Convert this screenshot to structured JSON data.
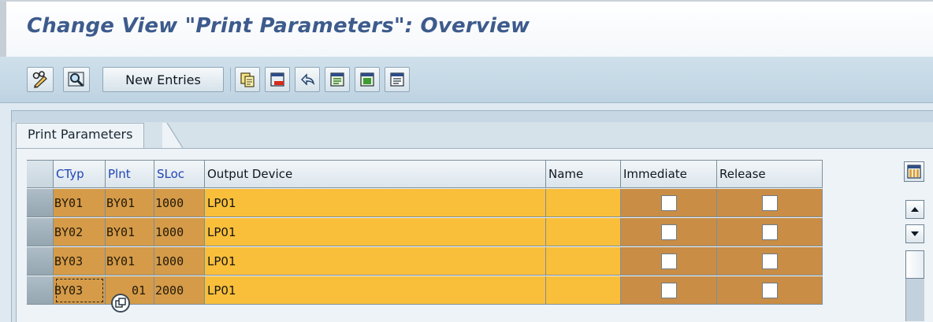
{
  "title": "Change View \"Print Parameters\": Overview",
  "toolbar": {
    "buttons": [
      {
        "name": "display-change-button",
        "icon": "pencil-glasses-icon"
      },
      {
        "name": "find-button",
        "icon": "magnifier-icon"
      },
      {
        "name": "new-entries-button",
        "label": "New Entries"
      },
      {
        "name": "copy-as-button",
        "icon": "copy-icon"
      },
      {
        "name": "delete-button",
        "icon": "delete-icon"
      },
      {
        "name": "undo-change-button",
        "icon": "undo-icon"
      },
      {
        "name": "select-all-button",
        "icon": "select-all-icon"
      },
      {
        "name": "select-block-button",
        "icon": "select-block-icon"
      },
      {
        "name": "deselect-all-button",
        "icon": "deselect-all-icon"
      }
    ]
  },
  "tab": {
    "label": "Print Parameters"
  },
  "table": {
    "columns": [
      {
        "key": "ctyp",
        "label": "CTyp",
        "is_key": true
      },
      {
        "key": "plnt",
        "label": "Plnt",
        "is_key": true
      },
      {
        "key": "sloc",
        "label": "SLoc",
        "is_key": true
      },
      {
        "key": "output_device",
        "label": "Output Device",
        "is_key": false
      },
      {
        "key": "name",
        "label": "Name",
        "is_key": false
      },
      {
        "key": "immediate",
        "label": "Immediate",
        "is_key": false
      },
      {
        "key": "release",
        "label": "Release",
        "is_key": false
      }
    ],
    "rows": [
      {
        "ctyp": "BY01",
        "plnt": "BY01",
        "sloc": "1000",
        "output_device": "LP01",
        "name": "",
        "immediate": false,
        "release": false
      },
      {
        "ctyp": "BY02",
        "plnt": "BY01",
        "sloc": "1000",
        "output_device": "LP01",
        "name": "",
        "immediate": false,
        "release": false
      },
      {
        "ctyp": "BY03",
        "plnt": "BY01",
        "sloc": "1000",
        "output_device": "LP01",
        "name": "",
        "immediate": false,
        "release": false
      },
      {
        "ctyp": "BY03",
        "plnt": "BY01",
        "sloc": "2000",
        "output_device": "LP01",
        "name": "",
        "immediate": false,
        "release": false
      }
    ],
    "partial_plnt_last_row": "01"
  },
  "colors": {
    "key_field_bg": "#d59b48",
    "input_field_bg": "#f9bf3a",
    "checkbox_cell_bg": "#c98d46",
    "title_color": "#3d5b8c",
    "key_header_color": "#1f45b5"
  },
  "scrollbar": {
    "up_icon": "scroll-up-icon",
    "down_icon": "scroll-down-icon",
    "column_settings_icon": "table-settings-icon"
  }
}
